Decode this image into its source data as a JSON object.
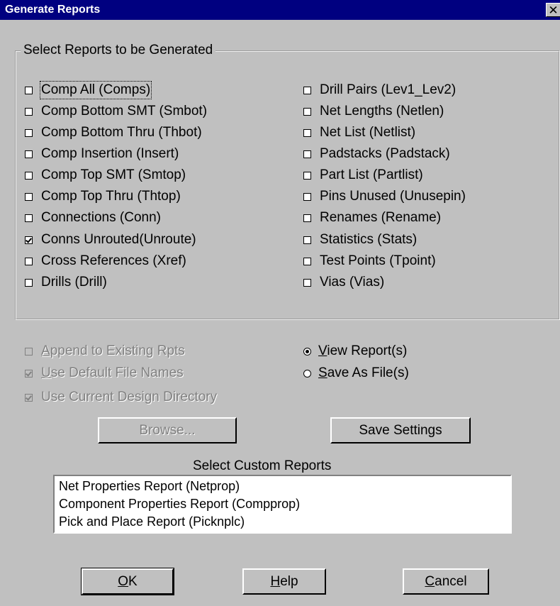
{
  "window": {
    "title": "Generate Reports",
    "close_glyph": "✕"
  },
  "reports_group": {
    "label": "Select Reports to be Generated",
    "left_column": [
      {
        "label": "Comp All (Comps)",
        "checked": false
      },
      {
        "label": "Comp Bottom SMT (Smbot)",
        "checked": false
      },
      {
        "label": "Comp Bottom Thru (Thbot)",
        "checked": false
      },
      {
        "label": "Comp Insertion (Insert)",
        "checked": false
      },
      {
        "label": "Comp Top SMT (Smtop)",
        "checked": false
      },
      {
        "label": "Comp Top Thru (Thtop)",
        "checked": false
      },
      {
        "label": "Connections (Conn)",
        "checked": false
      },
      {
        "label": "Conns Unrouted(Unroute)",
        "checked": true
      },
      {
        "label": "Cross References (Xref)",
        "checked": false
      },
      {
        "label": "Drills (Drill)",
        "checked": false
      }
    ],
    "right_column": [
      {
        "label": "Drill Pairs (Lev1_Lev2)",
        "checked": false
      },
      {
        "label": "Net Lengths (Netlen)",
        "checked": false
      },
      {
        "label": "Net List (Netlist)",
        "checked": false
      },
      {
        "label": "Padstacks (Padstack)",
        "checked": false
      },
      {
        "label": "Part List (Partlist)",
        "checked": false
      },
      {
        "label": "Pins Unused (Unusepin)",
        "checked": false
      },
      {
        "label": "Renames (Rename)",
        "checked": false
      },
      {
        "label": "Statistics (Stats)",
        "checked": false
      },
      {
        "label": "Test Points (Tpoint)",
        "checked": false
      },
      {
        "label": "Vias (Vias)",
        "checked": false
      }
    ]
  },
  "options": {
    "append": {
      "mnemonic": "A",
      "rest": "ppend to Existing Rpts",
      "checked": false,
      "enabled": false
    },
    "default_names": {
      "mnemonic": "U",
      "rest": "se Default File Names",
      "checked": true,
      "enabled": false
    },
    "current_dir": {
      "label": "Use Current Design Directory",
      "checked": true,
      "enabled": false
    }
  },
  "output_mode": {
    "view": {
      "mnemonic": "V",
      "rest": "iew Report(s)",
      "selected": true
    },
    "save": {
      "mnemonic": "S",
      "rest": "ave As File(s)",
      "selected": false
    }
  },
  "buttons": {
    "browse": "Browse...",
    "save_settings": "Save Settings",
    "ok": {
      "mnemonic": "O",
      "rest": "K"
    },
    "help": {
      "mnemonic": "H",
      "rest": "elp"
    },
    "cancel": {
      "mnemonic": "C",
      "rest": "ancel"
    }
  },
  "custom_reports": {
    "label": "Select Custom Reports",
    "items": [
      "Net Properties Report  (Netprop)",
      "Component Properties Report  (Compprop)",
      "Pick and Place Report  (Picknplc)"
    ]
  }
}
